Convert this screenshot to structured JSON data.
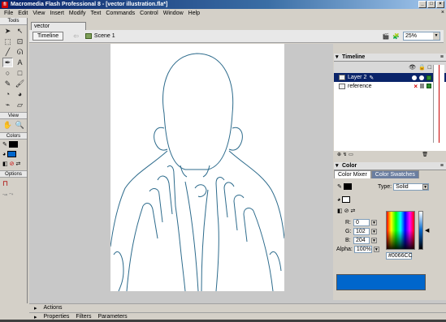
{
  "window": {
    "title": "Macromedia Flash Professional 8 - [vector illustration.fla*]",
    "app_icon": "fl"
  },
  "menu": [
    "File",
    "Edit",
    "View",
    "Insert",
    "Modify",
    "Text",
    "Commands",
    "Control",
    "Window",
    "Help"
  ],
  "tools_panel": {
    "title": "Tools",
    "view_label": "View",
    "colors_label": "Colors",
    "options_label": "Options",
    "stroke_color": "#000000",
    "fill_color": "#0066CC"
  },
  "document": {
    "tab": "vector illustration.fla*",
    "timeline_button": "Timeline",
    "scene": "Scene 1",
    "zoom": "25%"
  },
  "timeline": {
    "title": "Timeline",
    "layers": [
      {
        "name": "Layer 2",
        "selected": true
      },
      {
        "name": "reference",
        "selected": false
      }
    ]
  },
  "color_panel": {
    "title": "Color",
    "tabs": [
      "Color Mixer",
      "Color Swatches"
    ],
    "type_label": "Type:",
    "type_value": "Solid",
    "r_label": "R:",
    "r": "0",
    "g_label": "G:",
    "g": "102",
    "b_label": "B:",
    "b": "204",
    "alpha_label": "Alpha:",
    "alpha": "100%",
    "hex": "#0066CC",
    "preview_color": "#0066CC"
  },
  "bottom_panels": {
    "actions": "Actions",
    "tabs": [
      "Properties",
      "Filters",
      "Parameters"
    ]
  },
  "colors": {
    "line_art": "#2d6b8c",
    "stage": "#ffffff",
    "workspace": "#c8c8c8"
  }
}
